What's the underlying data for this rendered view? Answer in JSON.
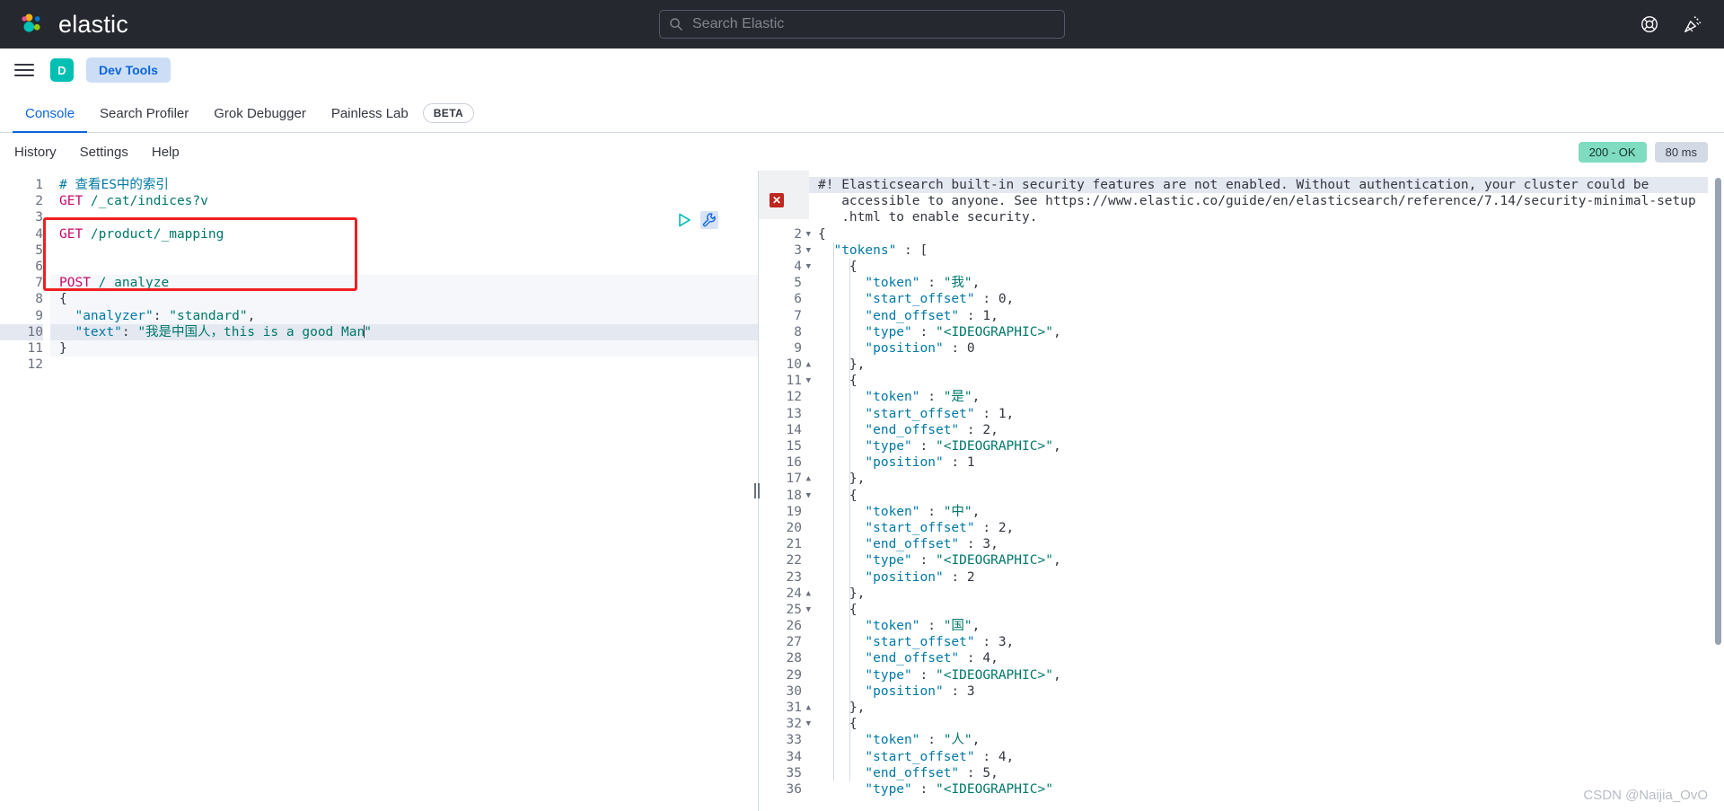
{
  "header": {
    "brand": "elastic",
    "search_placeholder": "Search Elastic",
    "icons": {
      "search": "search-icon",
      "help": "lifebuoy-help-icon",
      "whats_new": "party-popper-icon"
    }
  },
  "appnav": {
    "menu_icon": "hamburger-menu-icon",
    "space_initial": "D",
    "app_label": "Dev Tools"
  },
  "tabs": [
    {
      "label": "Console",
      "active": true,
      "badge": null
    },
    {
      "label": "Search Profiler",
      "active": false,
      "badge": null
    },
    {
      "label": "Grok Debugger",
      "active": false,
      "badge": null
    },
    {
      "label": "Painless Lab",
      "active": false,
      "badge": "BETA"
    }
  ],
  "console_menu": [
    "History",
    "Settings",
    "Help"
  ],
  "status": {
    "code": "200 - OK",
    "time": "80 ms",
    "ok_color": "#7fdcc0",
    "time_color": "#d3dae6"
  },
  "request_editor": {
    "actions": {
      "play": "play-request-icon",
      "wrench": "wrench-tools-icon"
    },
    "highlighted_line": 10,
    "lines": [
      {
        "n": 1,
        "tokens": [
          {
            "t": "# 查看ES中的索引",
            "c": "cmt"
          }
        ]
      },
      {
        "n": 2,
        "tokens": [
          {
            "t": "GET ",
            "c": "meth"
          },
          {
            "t": "/_cat/indices?v",
            "c": "url"
          }
        ]
      },
      {
        "n": 3,
        "tokens": []
      },
      {
        "n": 4,
        "tokens": [
          {
            "t": "GET ",
            "c": "meth"
          },
          {
            "t": "/product/_mapping",
            "c": "url"
          }
        ]
      },
      {
        "n": 5,
        "tokens": []
      },
      {
        "n": 6,
        "tokens": []
      },
      {
        "n": 7,
        "tokens": [
          {
            "t": "POST ",
            "c": "meth"
          },
          {
            "t": "/_analyze",
            "c": "url"
          }
        ]
      },
      {
        "n": 8,
        "tokens": [
          {
            "t": "{",
            "c": "punc"
          }
        ]
      },
      {
        "n": 9,
        "tokens": [
          {
            "t": "  ",
            "c": "punc"
          },
          {
            "t": "\"analyzer\"",
            "c": "key"
          },
          {
            "t": ": ",
            "c": "punc"
          },
          {
            "t": "\"standard\"",
            "c": "str"
          },
          {
            "t": ",",
            "c": "punc"
          }
        ]
      },
      {
        "n": 10,
        "tokens": [
          {
            "t": "  ",
            "c": "punc"
          },
          {
            "t": "\"text\"",
            "c": "key"
          },
          {
            "t": ": ",
            "c": "punc"
          },
          {
            "t": "\"我是中国人，this is a good Man",
            "c": "str"
          },
          {
            "t": "CARET",
            "c": "caret"
          },
          {
            "t": "\"",
            "c": "str"
          }
        ]
      },
      {
        "n": 11,
        "tokens": [
          {
            "t": "}",
            "c": "punc"
          }
        ]
      },
      {
        "n": 12,
        "tokens": []
      }
    ]
  },
  "response_editor": {
    "error_marker": "error-x-icon",
    "warning_text": [
      "#! Elasticsearch built-in security features are not enabled. Without authentication, your cluster could be",
      "   accessible to anyone. See https://www.elastic.co/guide/en/elasticsearch/reference/7.14/security-minimal-setup",
      "   .html to enable security."
    ],
    "lines": [
      {
        "n": 2,
        "fold": "open",
        "indent": 0,
        "tokens": [
          {
            "t": "{",
            "c": "punc"
          }
        ]
      },
      {
        "n": 3,
        "fold": "open",
        "indent": 1,
        "tokens": [
          {
            "t": "  ",
            "c": "punc"
          },
          {
            "t": "\"tokens\"",
            "c": "key"
          },
          {
            "t": " : [",
            "c": "punc"
          }
        ]
      },
      {
        "n": 4,
        "fold": "open",
        "indent": 2,
        "tokens": [
          {
            "t": "    {",
            "c": "punc"
          }
        ]
      },
      {
        "n": 5,
        "fold": null,
        "indent": 3,
        "tokens": [
          {
            "t": "      ",
            "c": "punc"
          },
          {
            "t": "\"token\"",
            "c": "key"
          },
          {
            "t": " : ",
            "c": "punc"
          },
          {
            "t": "\"我\"",
            "c": "str"
          },
          {
            "t": ",",
            "c": "punc"
          }
        ]
      },
      {
        "n": 6,
        "fold": null,
        "indent": 3,
        "tokens": [
          {
            "t": "      ",
            "c": "punc"
          },
          {
            "t": "\"start_offset\"",
            "c": "key"
          },
          {
            "t": " : ",
            "c": "punc"
          },
          {
            "t": "0",
            "c": "num"
          },
          {
            "t": ",",
            "c": "punc"
          }
        ]
      },
      {
        "n": 7,
        "fold": null,
        "indent": 3,
        "tokens": [
          {
            "t": "      ",
            "c": "punc"
          },
          {
            "t": "\"end_offset\"",
            "c": "key"
          },
          {
            "t": " : ",
            "c": "punc"
          },
          {
            "t": "1",
            "c": "num"
          },
          {
            "t": ",",
            "c": "punc"
          }
        ]
      },
      {
        "n": 8,
        "fold": null,
        "indent": 3,
        "tokens": [
          {
            "t": "      ",
            "c": "punc"
          },
          {
            "t": "\"type\"",
            "c": "key"
          },
          {
            "t": " : ",
            "c": "punc"
          },
          {
            "t": "\"<IDEOGRAPHIC>\"",
            "c": "str"
          },
          {
            "t": ",",
            "c": "punc"
          }
        ]
      },
      {
        "n": 9,
        "fold": null,
        "indent": 3,
        "tokens": [
          {
            "t": "      ",
            "c": "punc"
          },
          {
            "t": "\"position\"",
            "c": "key"
          },
          {
            "t": " : ",
            "c": "punc"
          },
          {
            "t": "0",
            "c": "num"
          }
        ]
      },
      {
        "n": 10,
        "fold": "close",
        "indent": 2,
        "tokens": [
          {
            "t": "    },",
            "c": "punc"
          }
        ]
      },
      {
        "n": 11,
        "fold": "open",
        "indent": 2,
        "tokens": [
          {
            "t": "    {",
            "c": "punc"
          }
        ]
      },
      {
        "n": 12,
        "fold": null,
        "indent": 3,
        "tokens": [
          {
            "t": "      ",
            "c": "punc"
          },
          {
            "t": "\"token\"",
            "c": "key"
          },
          {
            "t": " : ",
            "c": "punc"
          },
          {
            "t": "\"是\"",
            "c": "str"
          },
          {
            "t": ",",
            "c": "punc"
          }
        ]
      },
      {
        "n": 13,
        "fold": null,
        "indent": 3,
        "tokens": [
          {
            "t": "      ",
            "c": "punc"
          },
          {
            "t": "\"start_offset\"",
            "c": "key"
          },
          {
            "t": " : ",
            "c": "punc"
          },
          {
            "t": "1",
            "c": "num"
          },
          {
            "t": ",",
            "c": "punc"
          }
        ]
      },
      {
        "n": 14,
        "fold": null,
        "indent": 3,
        "tokens": [
          {
            "t": "      ",
            "c": "punc"
          },
          {
            "t": "\"end_offset\"",
            "c": "key"
          },
          {
            "t": " : ",
            "c": "punc"
          },
          {
            "t": "2",
            "c": "num"
          },
          {
            "t": ",",
            "c": "punc"
          }
        ]
      },
      {
        "n": 15,
        "fold": null,
        "indent": 3,
        "tokens": [
          {
            "t": "      ",
            "c": "punc"
          },
          {
            "t": "\"type\"",
            "c": "key"
          },
          {
            "t": " : ",
            "c": "punc"
          },
          {
            "t": "\"<IDEOGRAPHIC>\"",
            "c": "str"
          },
          {
            "t": ",",
            "c": "punc"
          }
        ]
      },
      {
        "n": 16,
        "fold": null,
        "indent": 3,
        "tokens": [
          {
            "t": "      ",
            "c": "punc"
          },
          {
            "t": "\"position\"",
            "c": "key"
          },
          {
            "t": " : ",
            "c": "punc"
          },
          {
            "t": "1",
            "c": "num"
          }
        ]
      },
      {
        "n": 17,
        "fold": "close",
        "indent": 2,
        "tokens": [
          {
            "t": "    },",
            "c": "punc"
          }
        ]
      },
      {
        "n": 18,
        "fold": "open",
        "indent": 2,
        "tokens": [
          {
            "t": "    {",
            "c": "punc"
          }
        ]
      },
      {
        "n": 19,
        "fold": null,
        "indent": 3,
        "tokens": [
          {
            "t": "      ",
            "c": "punc"
          },
          {
            "t": "\"token\"",
            "c": "key"
          },
          {
            "t": " : ",
            "c": "punc"
          },
          {
            "t": "\"中\"",
            "c": "str"
          },
          {
            "t": ",",
            "c": "punc"
          }
        ]
      },
      {
        "n": 20,
        "fold": null,
        "indent": 3,
        "tokens": [
          {
            "t": "      ",
            "c": "punc"
          },
          {
            "t": "\"start_offset\"",
            "c": "key"
          },
          {
            "t": " : ",
            "c": "punc"
          },
          {
            "t": "2",
            "c": "num"
          },
          {
            "t": ",",
            "c": "punc"
          }
        ]
      },
      {
        "n": 21,
        "fold": null,
        "indent": 3,
        "tokens": [
          {
            "t": "      ",
            "c": "punc"
          },
          {
            "t": "\"end_offset\"",
            "c": "key"
          },
          {
            "t": " : ",
            "c": "punc"
          },
          {
            "t": "3",
            "c": "num"
          },
          {
            "t": ",",
            "c": "punc"
          }
        ]
      },
      {
        "n": 22,
        "fold": null,
        "indent": 3,
        "tokens": [
          {
            "t": "      ",
            "c": "punc"
          },
          {
            "t": "\"type\"",
            "c": "key"
          },
          {
            "t": " : ",
            "c": "punc"
          },
          {
            "t": "\"<IDEOGRAPHIC>\"",
            "c": "str"
          },
          {
            "t": ",",
            "c": "punc"
          }
        ]
      },
      {
        "n": 23,
        "fold": null,
        "indent": 3,
        "tokens": [
          {
            "t": "      ",
            "c": "punc"
          },
          {
            "t": "\"position\"",
            "c": "key"
          },
          {
            "t": " : ",
            "c": "punc"
          },
          {
            "t": "2",
            "c": "num"
          }
        ]
      },
      {
        "n": 24,
        "fold": "close",
        "indent": 2,
        "tokens": [
          {
            "t": "    },",
            "c": "punc"
          }
        ]
      },
      {
        "n": 25,
        "fold": "open",
        "indent": 2,
        "tokens": [
          {
            "t": "    {",
            "c": "punc"
          }
        ]
      },
      {
        "n": 26,
        "fold": null,
        "indent": 3,
        "tokens": [
          {
            "t": "      ",
            "c": "punc"
          },
          {
            "t": "\"token\"",
            "c": "key"
          },
          {
            "t": " : ",
            "c": "punc"
          },
          {
            "t": "\"国\"",
            "c": "str"
          },
          {
            "t": ",",
            "c": "punc"
          }
        ]
      },
      {
        "n": 27,
        "fold": null,
        "indent": 3,
        "tokens": [
          {
            "t": "      ",
            "c": "punc"
          },
          {
            "t": "\"start_offset\"",
            "c": "key"
          },
          {
            "t": " : ",
            "c": "punc"
          },
          {
            "t": "3",
            "c": "num"
          },
          {
            "t": ",",
            "c": "punc"
          }
        ]
      },
      {
        "n": 28,
        "fold": null,
        "indent": 3,
        "tokens": [
          {
            "t": "      ",
            "c": "punc"
          },
          {
            "t": "\"end_offset\"",
            "c": "key"
          },
          {
            "t": " : ",
            "c": "punc"
          },
          {
            "t": "4",
            "c": "num"
          },
          {
            "t": ",",
            "c": "punc"
          }
        ]
      },
      {
        "n": 29,
        "fold": null,
        "indent": 3,
        "tokens": [
          {
            "t": "      ",
            "c": "punc"
          },
          {
            "t": "\"type\"",
            "c": "key"
          },
          {
            "t": " : ",
            "c": "punc"
          },
          {
            "t": "\"<IDEOGRAPHIC>\"",
            "c": "str"
          },
          {
            "t": ",",
            "c": "punc"
          }
        ]
      },
      {
        "n": 30,
        "fold": null,
        "indent": 3,
        "tokens": [
          {
            "t": "      ",
            "c": "punc"
          },
          {
            "t": "\"position\"",
            "c": "key"
          },
          {
            "t": " : ",
            "c": "punc"
          },
          {
            "t": "3",
            "c": "num"
          }
        ]
      },
      {
        "n": 31,
        "fold": "close",
        "indent": 2,
        "tokens": [
          {
            "t": "    },",
            "c": "punc"
          }
        ]
      },
      {
        "n": 32,
        "fold": "open",
        "indent": 2,
        "tokens": [
          {
            "t": "    {",
            "c": "punc"
          }
        ]
      },
      {
        "n": 33,
        "fold": null,
        "indent": 3,
        "tokens": [
          {
            "t": "      ",
            "c": "punc"
          },
          {
            "t": "\"token\"",
            "c": "key"
          },
          {
            "t": " : ",
            "c": "punc"
          },
          {
            "t": "\"人\"",
            "c": "str"
          },
          {
            "t": ",",
            "c": "punc"
          }
        ]
      },
      {
        "n": 34,
        "fold": null,
        "indent": 3,
        "tokens": [
          {
            "t": "      ",
            "c": "punc"
          },
          {
            "t": "\"start_offset\"",
            "c": "key"
          },
          {
            "t": " : ",
            "c": "punc"
          },
          {
            "t": "4",
            "c": "num"
          },
          {
            "t": ",",
            "c": "punc"
          }
        ]
      },
      {
        "n": 35,
        "fold": null,
        "indent": 3,
        "tokens": [
          {
            "t": "      ",
            "c": "punc"
          },
          {
            "t": "\"end_offset\"",
            "c": "key"
          },
          {
            "t": " : ",
            "c": "punc"
          },
          {
            "t": "5",
            "c": "num"
          },
          {
            "t": ",",
            "c": "punc"
          }
        ]
      },
      {
        "n": 36,
        "fold": null,
        "indent": 3,
        "tokens": [
          {
            "t": "      ",
            "c": "punc"
          },
          {
            "t": "\"type\"",
            "c": "key"
          },
          {
            "t": " : ",
            "c": "punc"
          },
          {
            "t": "\"<IDEOGRAPHIC>\"",
            "c": "str"
          }
        ]
      }
    ]
  },
  "watermark": "CSDN @Naijia_OvO"
}
